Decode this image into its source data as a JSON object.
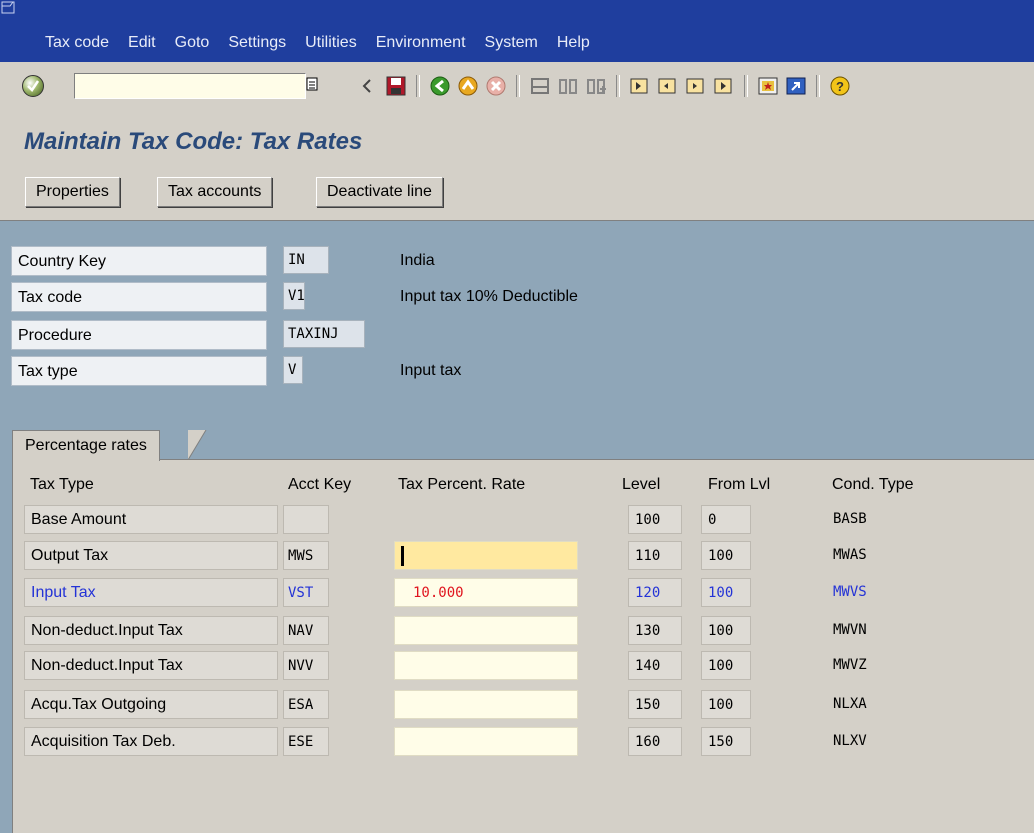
{
  "menu": [
    "Tax code",
    "Edit",
    "Goto",
    "Settings",
    "Utilities",
    "Environment",
    "System",
    "Help"
  ],
  "toolbar": {
    "command_value": "",
    "icons": [
      "enter-icon",
      "command-dropdown-icon",
      "back-arrow-icon",
      "save-icon",
      "back-icon",
      "exit-icon",
      "cancel-icon",
      "print-icon",
      "find-icon",
      "find-next-icon",
      "first-page-icon",
      "previous-page-icon",
      "next-page-icon",
      "last-page-icon",
      "create-session-icon",
      "shortcut-icon",
      "help-icon"
    ]
  },
  "title": "Maintain Tax Code: Tax Rates",
  "app_buttons": [
    "Properties",
    "Tax accounts",
    "Deactivate line"
  ],
  "header": {
    "country_key": {
      "label": "Country Key",
      "value": "IN",
      "text": "India"
    },
    "tax_code": {
      "label": "Tax code",
      "value": "V1",
      "text": "Input tax 10% Deductible"
    },
    "procedure": {
      "label": "Procedure",
      "value": "TAXINJ"
    },
    "tax_type": {
      "label": "Tax type",
      "value": "V",
      "text": "Input tax"
    }
  },
  "tab": "Percentage rates",
  "columns": {
    "tax_type": "Tax Type",
    "acct_key": "Acct Key",
    "rate": "Tax Percent. Rate",
    "level": "Level",
    "from": "From Lvl",
    "cond": "Cond. Type"
  },
  "rows": [
    {
      "type": "Base Amount",
      "key": "",
      "rate": "",
      "level": "100",
      "from": "0",
      "cond": "BASB"
    },
    {
      "type": "Output Tax",
      "key": "MWS",
      "rate": "",
      "level": "110",
      "from": "100",
      "cond": "MWAS"
    },
    {
      "type": "Input Tax",
      "key": "VST",
      "rate": "10.000",
      "level": "120",
      "from": "100",
      "cond": "MWVS"
    },
    {
      "type": "Non-deduct.Input Tax",
      "key": "NAV",
      "rate": "",
      "level": "130",
      "from": "100",
      "cond": "MWVN"
    },
    {
      "type": "Non-deduct.Input Tax",
      "key": "NVV",
      "rate": "",
      "level": "140",
      "from": "100",
      "cond": "MWVZ"
    },
    {
      "type": "Acqu.Tax Outgoing",
      "key": "ESA",
      "rate": "",
      "level": "150",
      "from": "100",
      "cond": "NLXA"
    },
    {
      "type": "Acquisition Tax Deb.",
      "key": "ESE",
      "rate": "",
      "level": "160",
      "from": "150",
      "cond": "NLXV"
    }
  ]
}
